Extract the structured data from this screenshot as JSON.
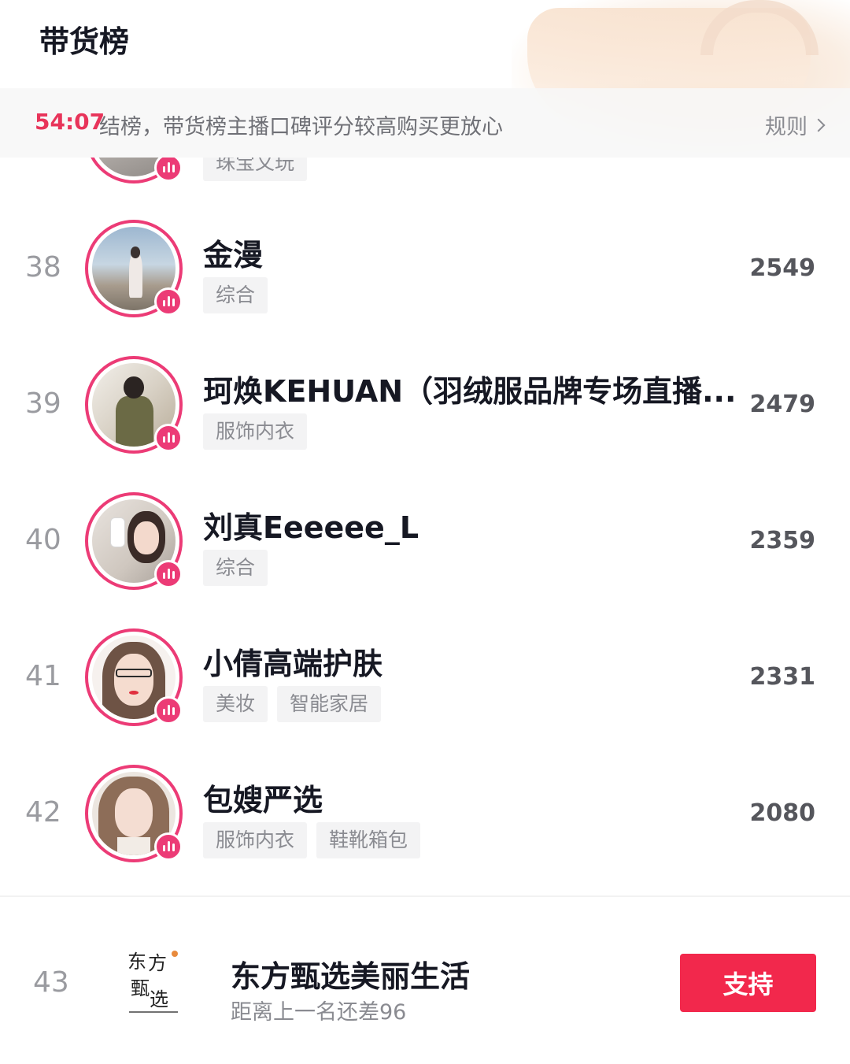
{
  "header": {
    "title": "带货榜",
    "countdown": "54:07",
    "notice": "结榜，带货榜主播口碑评分较高购买更放心",
    "rules_label": "规则"
  },
  "partial_row": {
    "tag": "珠宝文玩"
  },
  "ranking": [
    {
      "rank": "38",
      "name": "金漫",
      "tags": [
        "综合"
      ],
      "score": "2549"
    },
    {
      "rank": "39",
      "name": "珂焕KEHUAN（羽绒服品牌专场直播...",
      "tags": [
        "服饰内衣"
      ],
      "score": "2479"
    },
    {
      "rank": "40",
      "name": "刘真Eeeeee_L",
      "tags": [
        "综合"
      ],
      "score": "2359"
    },
    {
      "rank": "41",
      "name": "小倩高端护肤",
      "tags": [
        "美妆",
        "智能家居"
      ],
      "score": "2331"
    },
    {
      "rank": "42",
      "name": "包嫂严选",
      "tags": [
        "服饰内衣",
        "鞋靴箱包"
      ],
      "score": "2080"
    }
  ],
  "self": {
    "rank": "43",
    "name": "东方甄选美丽生活",
    "gap_text": "距离上一名还差96",
    "logo_text": "东方甄选",
    "support_label": "支持"
  },
  "colors": {
    "accent": "#f2284c",
    "live_ring": "#ec3b76",
    "countdown": "#e8345a"
  },
  "icons": {
    "live": "live-bars-icon",
    "rules": "chevron-right-icon"
  }
}
